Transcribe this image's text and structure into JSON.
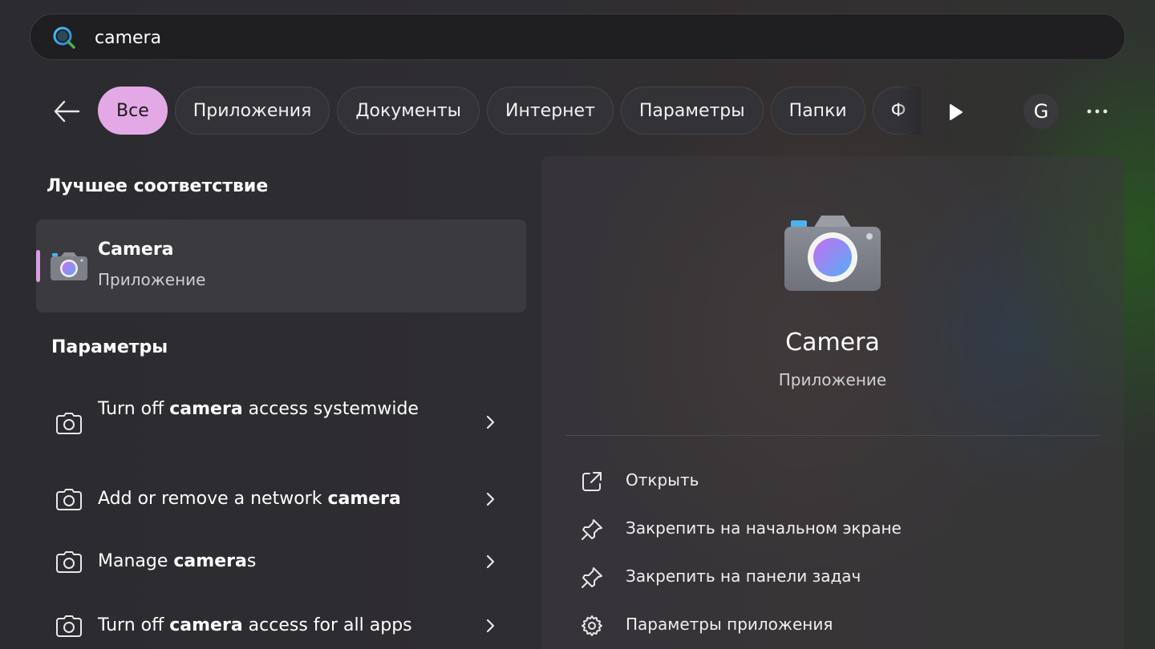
{
  "search": {
    "value": "camera",
    "icon": "search-icon"
  },
  "filters": {
    "back_icon": "back-arrow-icon",
    "chips": [
      {
        "label": "Все",
        "active": true
      },
      {
        "label": "Приложения",
        "active": false
      },
      {
        "label": "Документы",
        "active": false
      },
      {
        "label": "Интернет",
        "active": false
      },
      {
        "label": "Параметры",
        "active": false
      },
      {
        "label": "Папки",
        "active": false
      },
      {
        "label": "Ф",
        "active": false
      }
    ],
    "more_icon": "play-arrow-icon",
    "avatar_letter": "G",
    "overflow_icon": "more-horizontal-icon"
  },
  "best_match": {
    "heading": "Лучшее соответствие",
    "title": "Camera",
    "subtitle": "Приложение",
    "icon": "camera-app-icon"
  },
  "settings": {
    "heading": "Параметры",
    "items": [
      {
        "pre": "Turn off ",
        "bold": "camera",
        "post": " access systemwide"
      },
      {
        "pre": "Add or remove a network ",
        "bold": "camera",
        "post": ""
      },
      {
        "pre": "Manage ",
        "bold": "camera",
        "post": "s"
      },
      {
        "pre": "Turn off ",
        "bold": "camera",
        "post": " access for all apps"
      }
    ]
  },
  "detail": {
    "title": "Camera",
    "subtitle": "Приложение",
    "actions": [
      {
        "label": "Открыть",
        "icon": "open-external-icon"
      },
      {
        "label": "Закрепить на начальном экране",
        "icon": "pin-icon"
      },
      {
        "label": "Закрепить на панели задач",
        "icon": "pin-icon"
      },
      {
        "label": "Параметры приложения",
        "icon": "gear-icon"
      }
    ]
  },
  "colors": {
    "accent": "#e3a9e6",
    "background": "#2a2a2d"
  }
}
